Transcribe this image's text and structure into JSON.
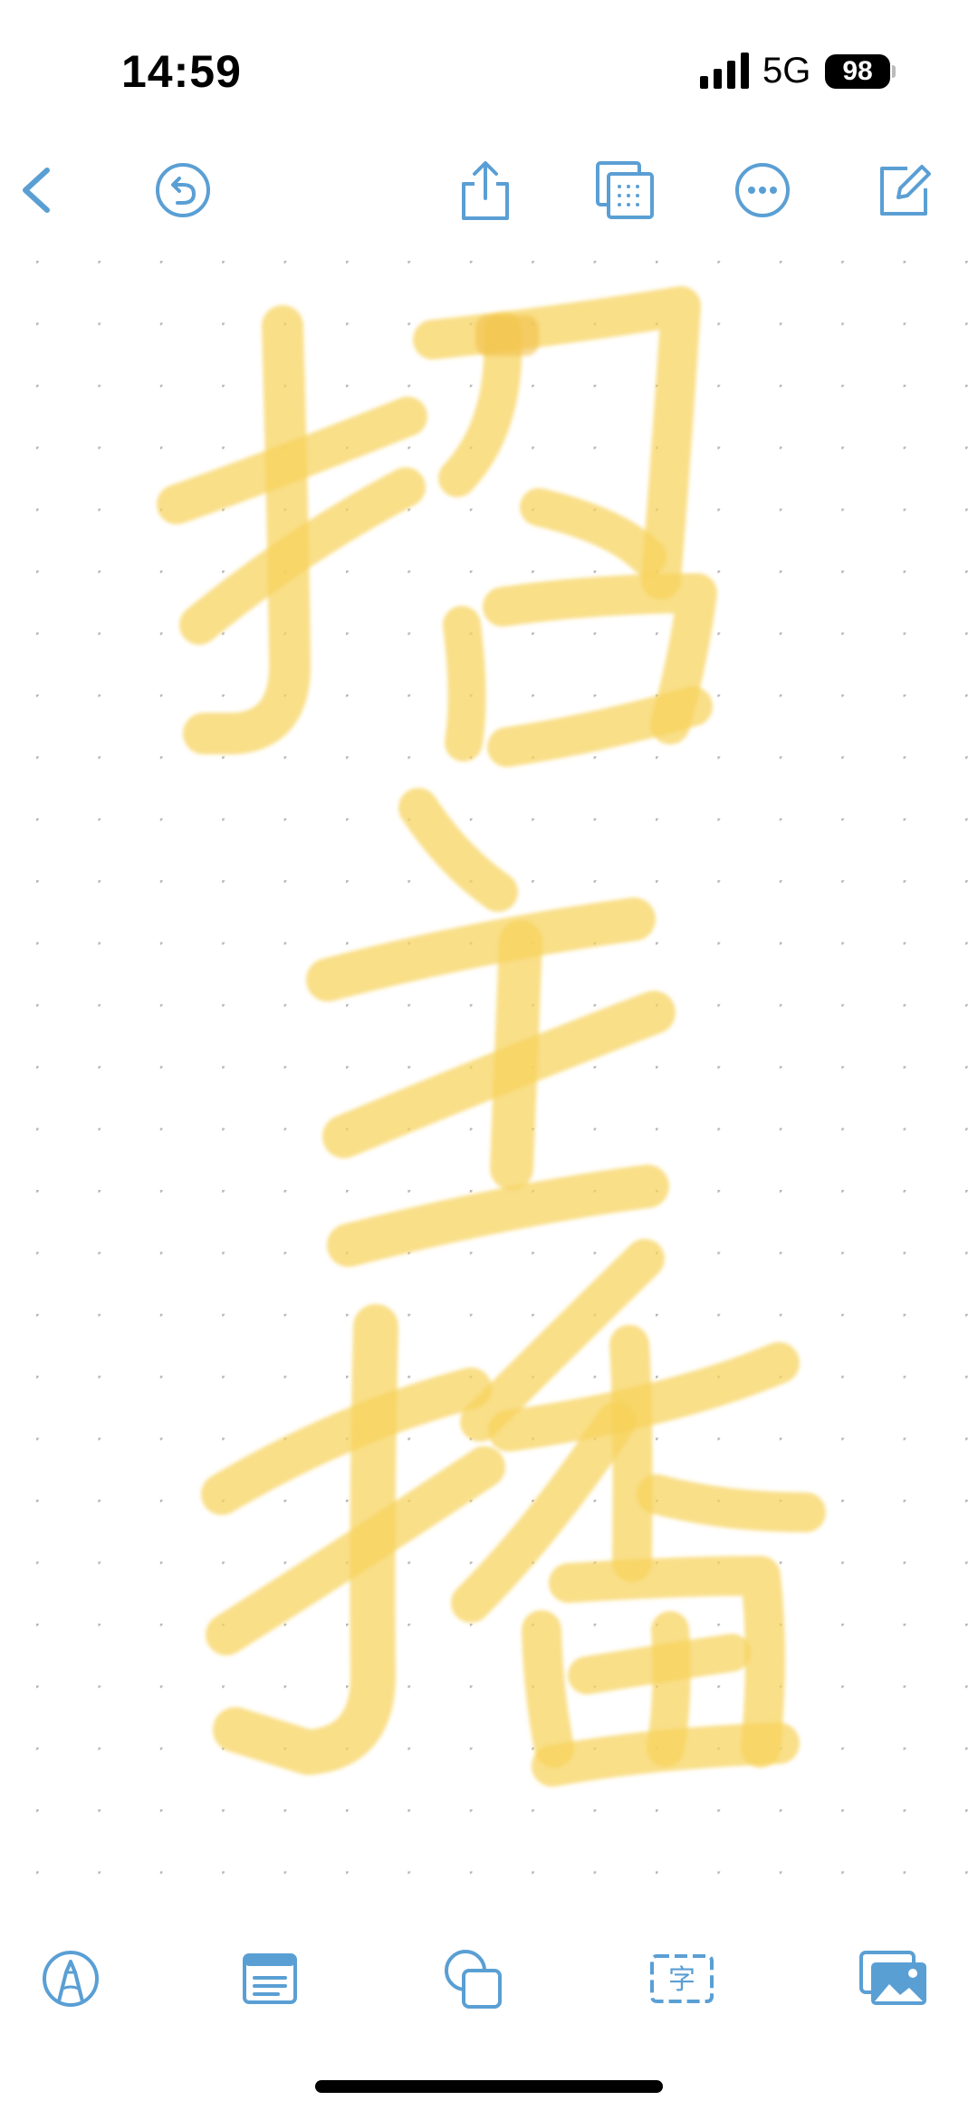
{
  "status_bar": {
    "time": "14:59",
    "network": "5G",
    "battery": "98"
  },
  "colors": {
    "accent": "#5a9fd4",
    "ink_highlighter": "#f7d35a",
    "grid_dot": "#b8b8b8"
  },
  "top_toolbar": {
    "icons": [
      "chevron-left-icon",
      "undo-icon",
      "share-icon",
      "page-grid-icon",
      "more-icon",
      "compose-icon"
    ]
  },
  "canvas": {
    "handwriting_characters": [
      "招",
      "主",
      "播"
    ]
  },
  "bottom_toolbar": {
    "icons": [
      "pen-tool-icon",
      "text-note-icon",
      "shapes-icon",
      "text-box-icon",
      "image-icon"
    ],
    "text_box_glyph": "字"
  }
}
